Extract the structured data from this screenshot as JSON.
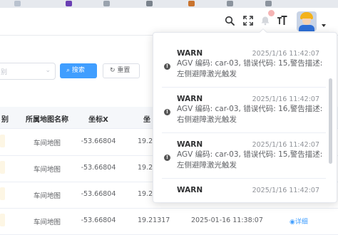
{
  "header": {
    "icons": [
      "search-icon",
      "fullscreen-icon",
      "bell-icon",
      "font-size-icon",
      "avatar",
      "chevron-down-icon"
    ]
  },
  "filter": {
    "select_placeholder": "别",
    "search_label": "搜索",
    "reset_label": "重置"
  },
  "table": {
    "headers": [
      "别",
      "所属地图名称",
      "坐标X",
      "坐"
    ],
    "rows": [
      {
        "map": "车间地图",
        "x": "-53.66804",
        "y": "19.2"
      },
      {
        "map": "车间地图",
        "x": "-53.66804",
        "y": "19.2"
      },
      {
        "map": "车间地图",
        "x": "-53.66804",
        "y": "19.2"
      },
      {
        "map": "车间地图",
        "x": "-53.66804",
        "y": "19.21317",
        "time": "2025-01-16 11:38:07",
        "detail": "详细"
      }
    ]
  },
  "notifications": [
    {
      "level": "WARN",
      "time": "2025/1/16 11:42:07",
      "message": "AGV 编码: car-03, 错误代码: 15,警告描述: 左侧避障激光触发"
    },
    {
      "level": "WARN",
      "time": "2025/1/16 11:42:07",
      "message": "AGV 编码: car-03, 错误代码: 16,警告描述: 右侧避障激光触发"
    },
    {
      "level": "WARN",
      "time": "2025/1/16 11:42:07",
      "message": "AGV 编码: car-03, 错误代码: 15,警告描述: 左侧避障激光触发"
    },
    {
      "level": "WARN",
      "time": "2025/1/16 11:42:07",
      "message": ""
    }
  ],
  "colors": {
    "primary": "#409eff",
    "warn_icon": "#555555",
    "tag": "#fdf6e4"
  }
}
